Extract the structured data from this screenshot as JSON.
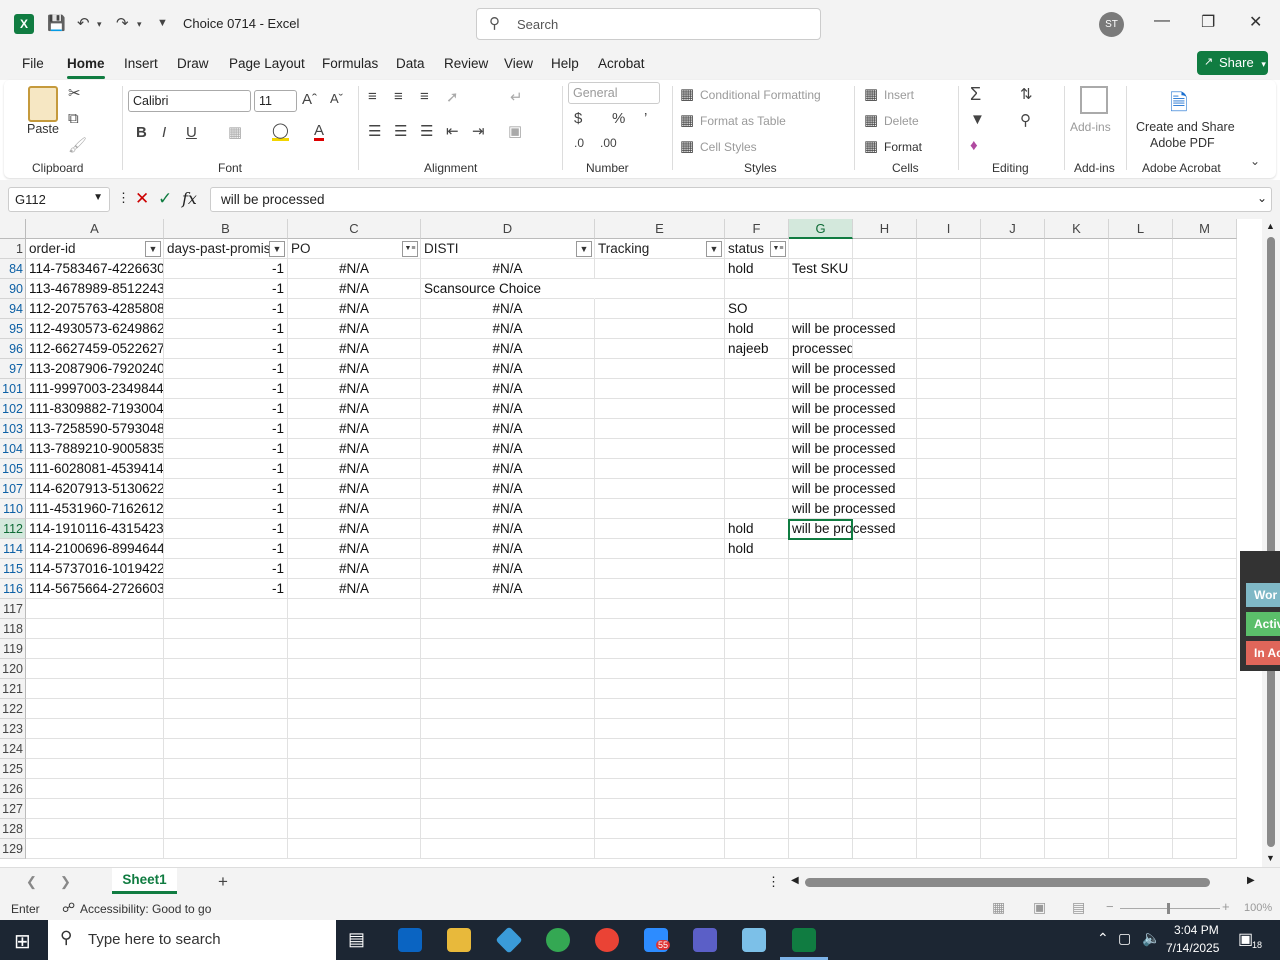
{
  "window": {
    "title": "Choice 0714  -  Excel",
    "search_placeholder": "Search",
    "avatar_initials": "ST"
  },
  "menu": {
    "tabs": [
      "File",
      "Home",
      "Insert",
      "Draw",
      "Page Layout",
      "Formulas",
      "Data",
      "Review",
      "View",
      "Help",
      "Acrobat"
    ],
    "share_label": "Share"
  },
  "ribbon": {
    "paste": "Paste",
    "clipboard": "Clipboard",
    "font_name": "Calibri",
    "font_size": "11",
    "font_group": "Font",
    "alignment_group": "Alignment",
    "number_format": "General",
    "number_group": "Number",
    "cond_format": "Conditional Formatting",
    "format_table": "Format as Table",
    "cell_styles": "Cell Styles",
    "styles_group": "Styles",
    "insert": "Insert",
    "delete": "Delete",
    "format": "Format",
    "cells_group": "Cells",
    "editing_group": "Editing",
    "addins": "Add-ins",
    "addins_group": "Add-ins",
    "create_pdf_1": "Create and Share",
    "create_pdf_2": "Adobe PDF",
    "acrobat_group": "Adobe Acrobat"
  },
  "formula_bar": {
    "name_box": "G112",
    "content": "will be processed"
  },
  "columns": [
    "A",
    "B",
    "C",
    "D",
    "E",
    "F",
    "G",
    "H",
    "I",
    "J",
    "K",
    "L",
    "M"
  ],
  "headers": {
    "A": "order-id",
    "B": "days-past-promise",
    "C": "PO",
    "D": "DISTI",
    "E": "Tracking",
    "F": "status"
  },
  "rows": [
    {
      "n": "84",
      "a": "114-7583467-4226630",
      "b": "-1",
      "c": "#N/A",
      "d": "#N/A",
      "f": "hold",
      "g": "Test SKU"
    },
    {
      "n": "90",
      "a": "113-4678989-8512243",
      "b": "-1",
      "c": "#N/A",
      "d": "Scansource Choice",
      "f": "",
      "g": ""
    },
    {
      "n": "94",
      "a": "112-2075763-4285808",
      "b": "-1",
      "c": "#N/A",
      "d": "#N/A",
      "f": "SO",
      "g": ""
    },
    {
      "n": "95",
      "a": "112-4930573-6249862",
      "b": "-1",
      "c": "#N/A",
      "d": "#N/A",
      "f": "hold",
      "g": "will be processed"
    },
    {
      "n": "96",
      "a": "112-6627459-0522627",
      "b": "-1",
      "c": "#N/A",
      "d": "#N/A",
      "f": "najeeb",
      "g": "processed"
    },
    {
      "n": "97",
      "a": "113-2087906-7920240",
      "b": "-1",
      "c": "#N/A",
      "d": "#N/A",
      "f": "",
      "g": "will be processed"
    },
    {
      "n": "101",
      "a": "111-9997003-2349844",
      "b": "-1",
      "c": "#N/A",
      "d": "#N/A",
      "f": "",
      "g": "will be processed"
    },
    {
      "n": "102",
      "a": "111-8309882-7193004",
      "b": "-1",
      "c": "#N/A",
      "d": "#N/A",
      "f": "",
      "g": "will be processed"
    },
    {
      "n": "103",
      "a": "113-7258590-5793048",
      "b": "-1",
      "c": "#N/A",
      "d": "#N/A",
      "f": "",
      "g": "will be processed"
    },
    {
      "n": "104",
      "a": "113-7889210-9005835",
      "b": "-1",
      "c": "#N/A",
      "d": "#N/A",
      "f": "",
      "g": "will be processed"
    },
    {
      "n": "105",
      "a": "111-6028081-4539414",
      "b": "-1",
      "c": "#N/A",
      "d": "#N/A",
      "f": "",
      "g": "will be processed"
    },
    {
      "n": "107",
      "a": "114-6207913-5130622",
      "b": "-1",
      "c": "#N/A",
      "d": "#N/A",
      "f": "",
      "g": "will be processed"
    },
    {
      "n": "110",
      "a": "111-4531960-7162612",
      "b": "-1",
      "c": "#N/A",
      "d": "#N/A",
      "f": "",
      "g": "will be processed"
    },
    {
      "n": "112",
      "a": "114-1910116-4315423",
      "b": "-1",
      "c": "#N/A",
      "d": "#N/A",
      "f": "hold",
      "g": "will be processed"
    },
    {
      "n": "114",
      "a": "114-2100696-8994644",
      "b": "-1",
      "c": "#N/A",
      "d": "#N/A",
      "f": "hold",
      "g": ""
    },
    {
      "n": "115",
      "a": "114-5737016-1019422",
      "b": "-1",
      "c": "#N/A",
      "d": "#N/A",
      "f": "",
      "g": ""
    },
    {
      "n": "116",
      "a": "114-5675664-2726603",
      "b": "-1",
      "c": "#N/A",
      "d": "#N/A",
      "f": "",
      "g": ""
    }
  ],
  "empty_rows": [
    "117",
    "118",
    "119",
    "120",
    "121",
    "122",
    "123",
    "124",
    "125",
    "126",
    "127",
    "128",
    "129"
  ],
  "sheet_tab": "Sheet1",
  "side_panel": [
    "Wor",
    "Activ",
    "In Ac"
  ],
  "status": {
    "mode": "Enter",
    "accessibility": "Accessibility: Good to go",
    "zoom": "100%"
  },
  "taskbar": {
    "search_placeholder": "Type here to search",
    "time": "3:04 PM",
    "date": "7/14/2025",
    "notif_count": "18",
    "zoom_badge": "55"
  }
}
